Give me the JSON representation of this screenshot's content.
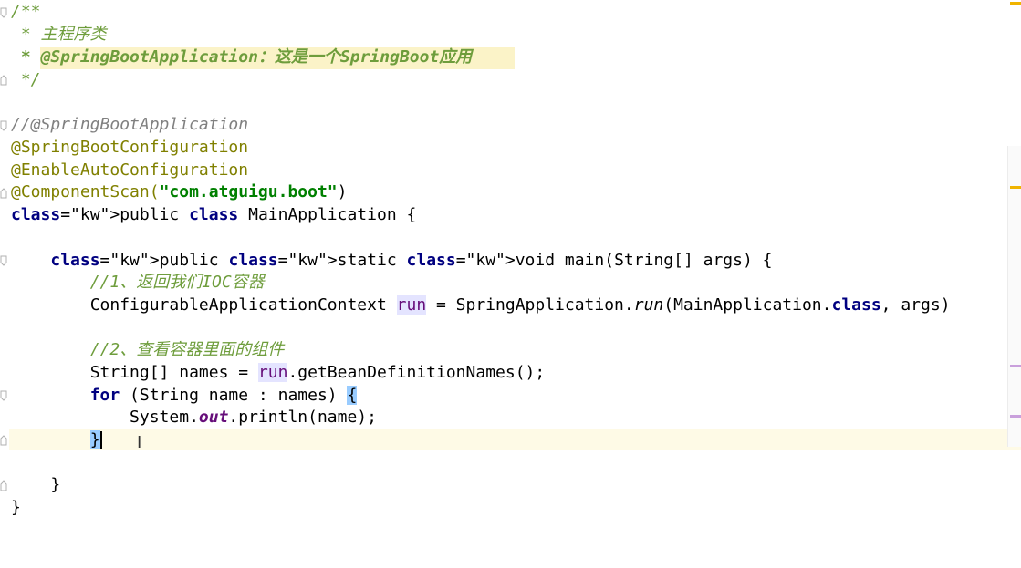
{
  "editor": {
    "lines": [
      "/**",
      " * 主程序类",
      " * @SpringBootApplication：这是一个SpringBoot应用",
      " */",
      "",
      "//@SpringBootApplication",
      "@SpringBootConfiguration",
      "@EnableAutoConfiguration",
      "@ComponentScan(\"com.atguigu.boot\")",
      "public class MainApplication {",
      "",
      "    public static void main(String[] args) {",
      "        //1、返回我们IOC容器",
      "        ConfigurableApplicationContext run = SpringApplication.run(MainApplication.class, args)",
      "",
      "        //2、查看容器里面的组件",
      "        String[] names = run.getBeanDefinitionNames();",
      "        for (String name : names) {",
      "            System.out.println(name);",
      "        }",
      "",
      "    }",
      "}"
    ]
  },
  "colors": {
    "keyword": "#000080",
    "annotation": "#808000",
    "string": "#008000",
    "doc_comment": "#6e9d3c",
    "line_comment": "#808080",
    "static_field": "#660e7a",
    "caret_line": "#fefae6",
    "brace_match": "#99ccff"
  },
  "icons": {
    "fold": "fold-marker-icon",
    "cursor": "i-beam-cursor-icon"
  }
}
